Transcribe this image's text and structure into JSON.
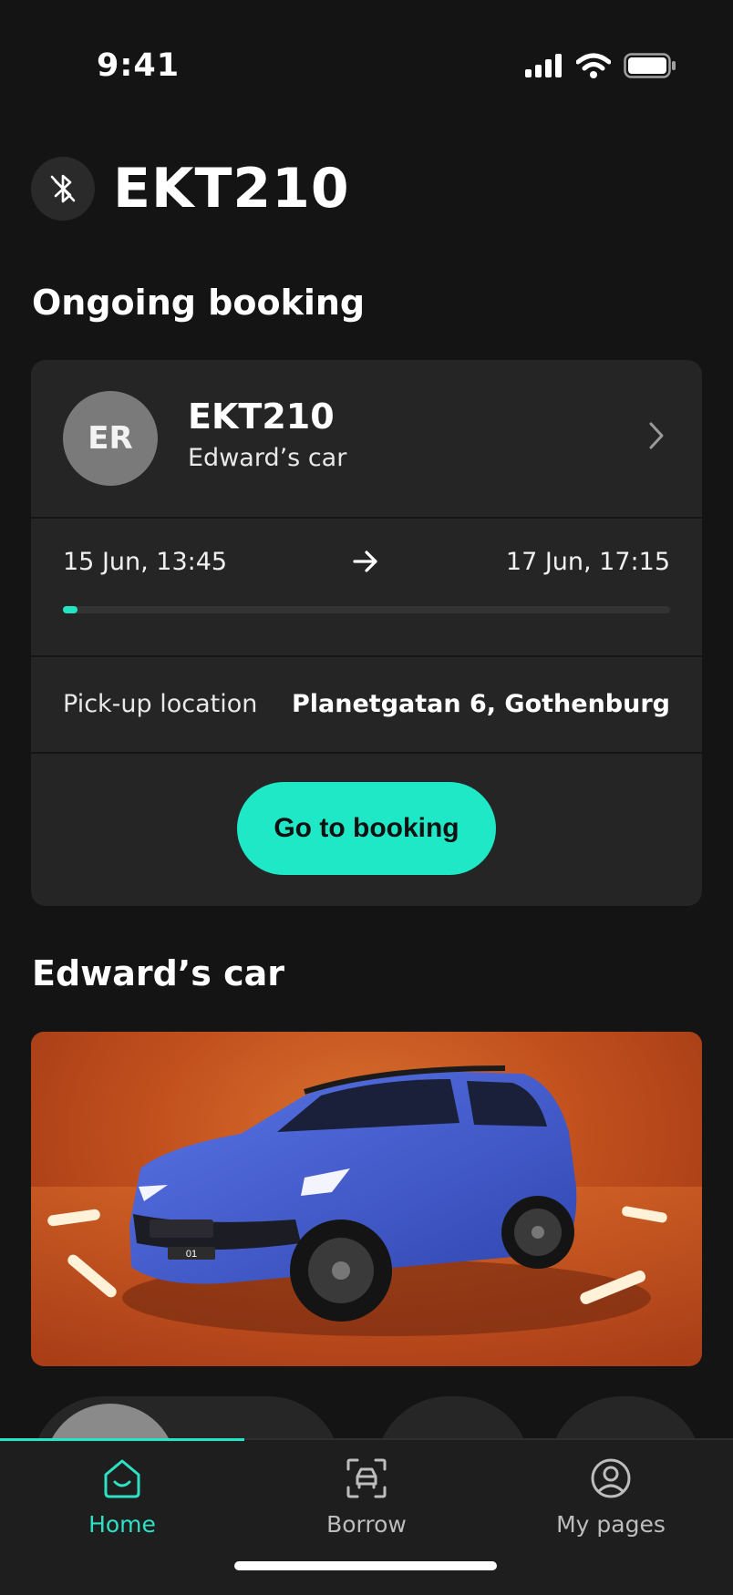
{
  "status_bar": {
    "time": "9:41"
  },
  "header": {
    "title": "EKT210",
    "bluetooth_icon": "bluetooth-off-icon"
  },
  "ongoing": {
    "section_title": "Ongoing booking",
    "avatar_initials": "ER",
    "plate": "EKT210",
    "car_name": "Edward’s car",
    "start": "15 Jun, 13:45",
    "end": "17 Jun, 17:15",
    "progress": 0.02,
    "pickup_label": "Pick-up location",
    "pickup_value": "Planetgatan 6, Gothenburg",
    "cta": "Go to booking"
  },
  "car_section": {
    "title": "Edward’s car",
    "plate_on_car": "01"
  },
  "tabs": [
    {
      "label": "Home",
      "icon": "home-icon",
      "active": true
    },
    {
      "label": "Borrow",
      "icon": "car-scan-icon",
      "active": false
    },
    {
      "label": "My pages",
      "icon": "profile-icon",
      "active": false
    }
  ],
  "colors": {
    "accent": "#1ee8c6",
    "background": "#141414",
    "card": "#252525"
  }
}
